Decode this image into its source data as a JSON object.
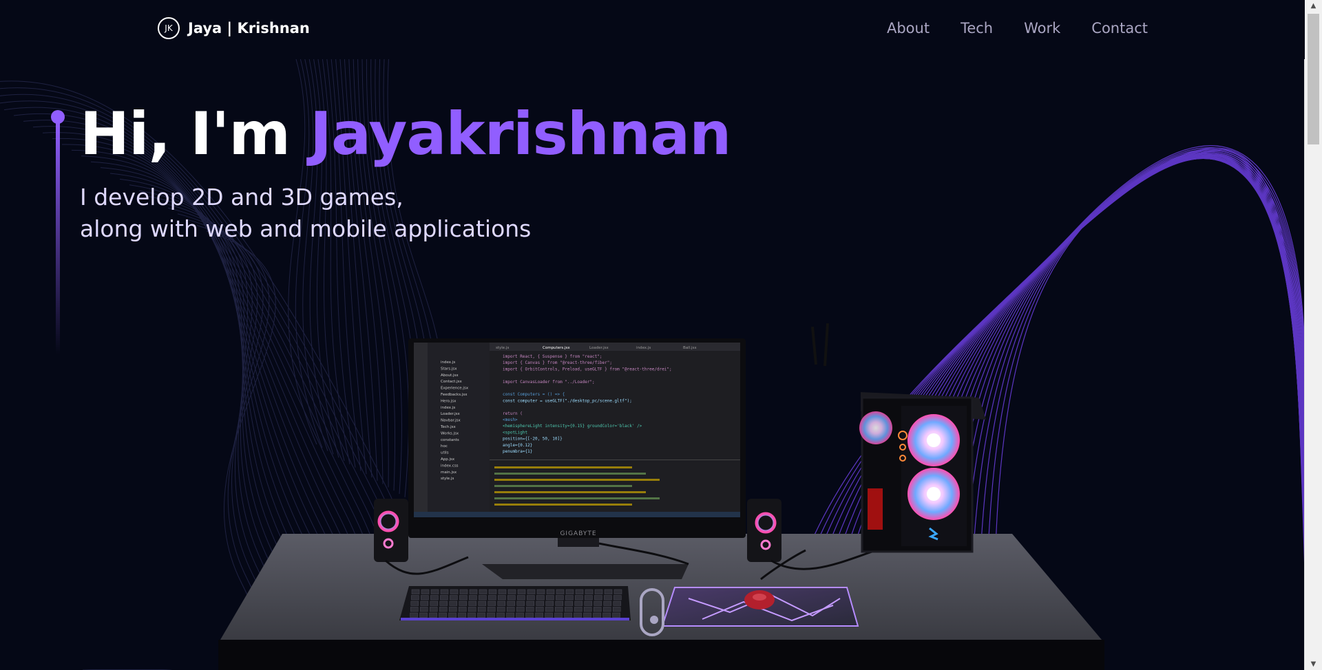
{
  "logo": {
    "mark": "JK",
    "text": "Jaya | Krishnan"
  },
  "nav": {
    "links": [
      "About",
      "Tech",
      "Work",
      "Contact"
    ]
  },
  "hero": {
    "greeting": "Hi, I'm ",
    "name": "Jayakrishnan",
    "subtitle_line1": "I develop 2D and 3D games,",
    "subtitle_line2": "along with web and mobile applications"
  },
  "scene": {
    "monitor_brand": "GIGABYTE",
    "editor_tabs": [
      "style.js",
      "Computers.jsx",
      "Loader.jsx",
      "index.js",
      "Ball.jsx"
    ],
    "explorer_files": [
      "index.js",
      "Stars.jsx",
      "About.jsx",
      "Contact.jsx",
      "Experience.jsx",
      "Feedbacks.jsx",
      "Hero.jsx",
      "index.js",
      "Loader.jsx",
      "Navbar.jsx",
      "Tech.jsx",
      "Works.jsx",
      "constants",
      "hoc",
      "utils",
      "App.jsx",
      "index.css",
      "main.jsx",
      "style.js"
    ],
    "code_lines": [
      "import React, { Suspense } from \"react\";",
      "import { Canvas } from \"@react-three/fiber\";",
      "import { OrbitControls, Preload, useGLTF } from \"@react-three/drei\";",
      "",
      "import CanvasLoader from \"../Loader\";",
      "",
      "const Computers = () => {",
      "  const computer = useGLTF(\"./desktop_pc/scene.gltf\");",
      "",
      "  return (",
      "    <mesh>",
      "      <hemisphereLight intensity={0.15} groundColor='black' />",
      "      <spotLight",
      "        position={[-20, 50, 10]}",
      "        angle={0.12}",
      "        penumbra={1}"
    ]
  },
  "colors": {
    "background": "#050816",
    "accent": "#915eff",
    "nav_text": "#aaa6c3",
    "subtitle": "#dfd9ff"
  }
}
